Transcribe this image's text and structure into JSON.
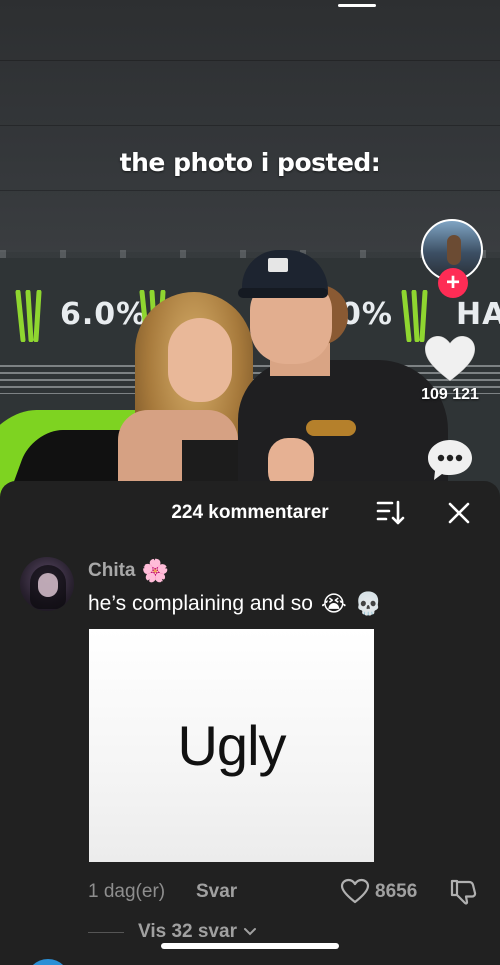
{
  "video": {
    "caption": "the photo i posted:",
    "banner_texts": [
      "6.0%",
      "0%",
      "HAR"
    ],
    "likes": "109 121"
  },
  "comments_sheet": {
    "title": "224 kommentarer",
    "comment": {
      "author": "Chita",
      "author_emoji": "🌸",
      "text": "he’s complaining and so",
      "text_emojis": [
        "😭",
        "💀"
      ],
      "image_text": "Ugly",
      "time": "1 dag(er)",
      "reply_label": "Svar",
      "like_count": "8656",
      "view_replies": "Vis 32 svar"
    }
  },
  "colors": {
    "accent": "#fe2c55",
    "sheet_bg": "#212121",
    "muted_text": "#a0a0a0"
  }
}
